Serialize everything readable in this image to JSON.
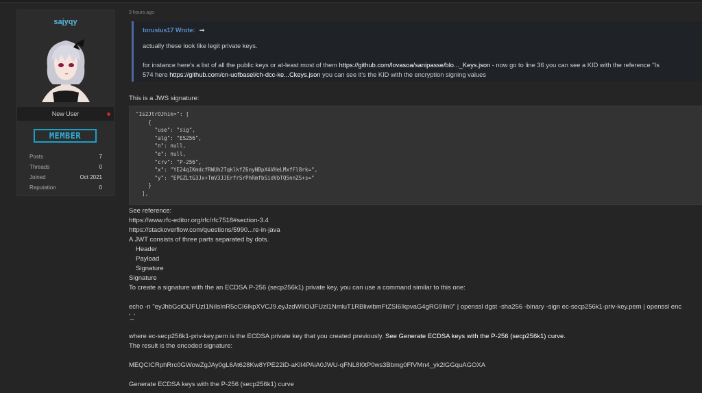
{
  "user": {
    "name": "sajyqy",
    "title": "New User",
    "rank": "MEMBER",
    "stats": [
      {
        "label": "Posts",
        "value": "7"
      },
      {
        "label": "Threads",
        "value": "0"
      },
      {
        "label": "Joined",
        "value": "Oct 2021"
      },
      {
        "label": "Reputation",
        "value": "0"
      }
    ]
  },
  "post": {
    "time": "3 hours ago",
    "quote": {
      "author": "torusius17 Wrote:",
      "arrow": "➞",
      "line1": "actually these look like legit private keys.",
      "line2_pre": "for instance here's a list of all the public keys or at-least most of them ",
      "line2_link": "https://github.com/lovasoa/sanipasse/blo..._Keys.json",
      "line2_post": " - now go to line 36 you can see a KID with the reference \"Is",
      "line3_pre": "574 here ",
      "line3_link": "https://github.com/cn-uofbasel/ch-dcc-ke...Ckeys.json",
      "line3_post": " you can see it's the KID with the encryption signing values"
    },
    "jws_intro": "This is a JWS signature:",
    "code": "\"Is2JtrOJhik=\": [\n    {\n      \"use\": \"sig\",\n      \"alg\": \"ES256\",\n      \"n\": null,\n      \"e\": null,\n      \"crv\": \"P-256\",\n      \"x\": \"YE24qIKmdcfRWUh2TqklkfZ6nyNBpX4VHeLMxfFl8rk=\",\n      \"y\": \"EPGZLtG3Jx+TmV3JJErfrSrPhRmfbSidVbTQ5nnZS+s=\"\n    }\n  ],",
    "see_reference": "See reference:",
    "ref1": "https://www.rfc-editor.org/rfc/rfc7518#section-3.4",
    "ref2": "https://stackoverflow.com/questions/5990...re-in-java",
    "jwt_intro": "A JWT consists of three parts separated by dots.",
    "part1": "Header",
    "part2": "Payload",
    "part3": "Signature",
    "signature_label": "Signature",
    "create_text": "To create a signature with the an ECDSA P-256 (secp256k1) private key, you can use a command similar to this one:",
    "echo_cmd": "echo -n \"eyJhbGciOiJFUzI1NiIsInR5cCI6IkpXVCJ9.eyJzdWIiOiJFUzI1NmluT1RBliwibmFtZSI6IkpvaG4gRG9lIn0\" | openssl dgst -sha256 -binary -sign ec-secp256k1-priv-key.pem | openssl enc",
    "echo_cont": "'_'",
    "where_pre": "where ec-secp256k1-priv-key.pem is the ECDSA private key that you created previously. ",
    "where_link": "See Generate ECDSA keys with the P-256 (secp256k1) curve.",
    "result_text": "The result is the encoded signature:",
    "encoded_sig": "MEQCICRphRrc0GWowZgJAy0gL6At628Kw8YPE22iD-aKlI4PAiA0JWU-qFNL8I0tP0ws3Bbmg0FfVMn4_yk2lGGquAGOXA",
    "generate_text": "Generate ECDSA keys with the P-256 (secp256k1) curve"
  }
}
